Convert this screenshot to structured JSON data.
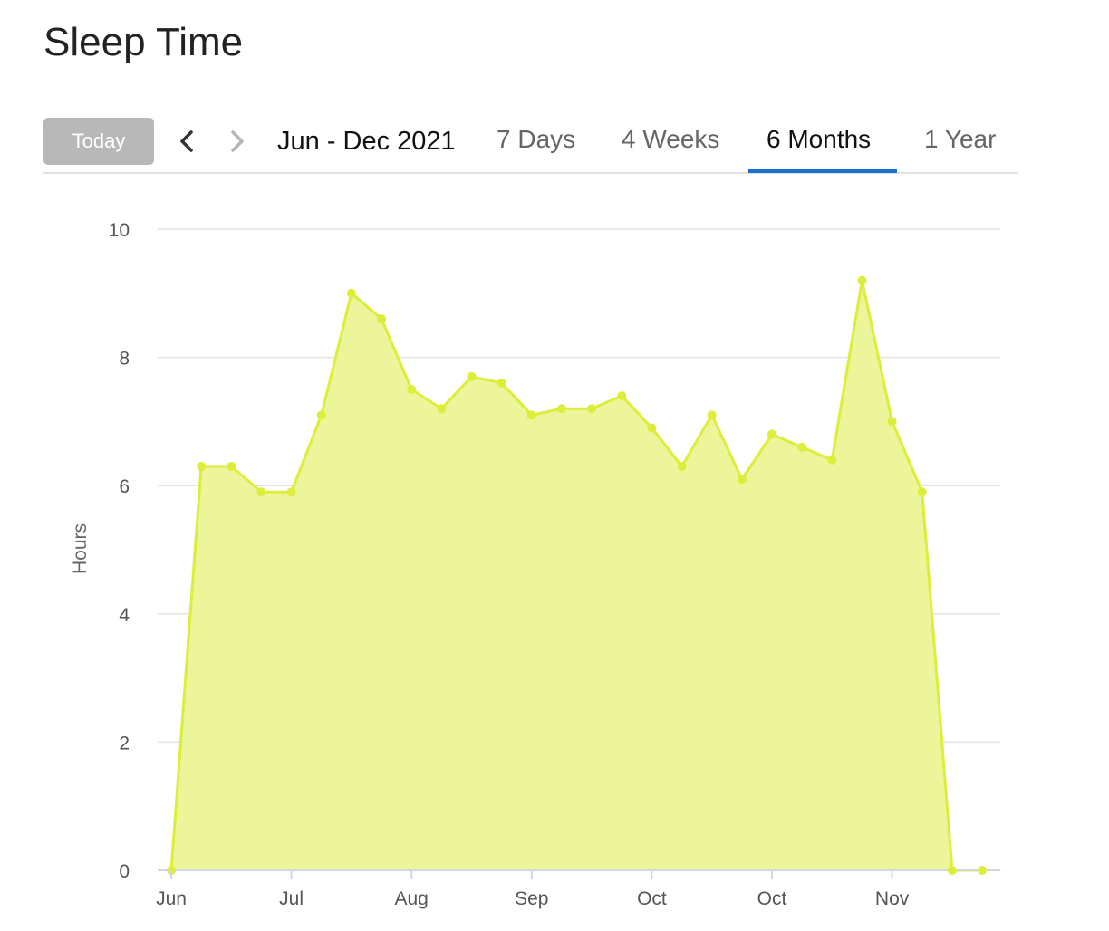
{
  "page": {
    "title": "Sleep Time"
  },
  "toolbar": {
    "today_label": "Today",
    "prev_icon": "chevron-left-icon",
    "next_icon": "chevron-right-icon",
    "range_label": "Jun - Dec 2021",
    "tabs": [
      {
        "label": "7 Days",
        "active": false
      },
      {
        "label": "4 Weeks",
        "active": false
      },
      {
        "label": "6 Months",
        "active": true
      },
      {
        "label": "1 Year",
        "active": false
      }
    ],
    "accent_color": "#1a6fd1"
  },
  "chart_data": {
    "type": "area",
    "title": "",
    "xlabel": "",
    "ylabel": "Hours",
    "ylim": [
      0,
      10
    ],
    "yticks": [
      0,
      2,
      4,
      6,
      8,
      10
    ],
    "grid": true,
    "x_tick_labels": [
      "Jun",
      "Jul",
      "Aug",
      "Sep",
      "Oct",
      "Oct",
      "Nov"
    ],
    "series": [
      {
        "color": "#dcee3a",
        "fill_color": "#ecf59a",
        "values": [
          0,
          6.3,
          6.3,
          5.9,
          5.9,
          7.1,
          9.0,
          8.6,
          7.5,
          7.2,
          7.7,
          7.6,
          7.1,
          7.2,
          7.2,
          7.4,
          6.9,
          6.3,
          7.1,
          6.1,
          6.8,
          6.6,
          6.4,
          9.2,
          7.0,
          5.9,
          0,
          0
        ]
      }
    ]
  }
}
